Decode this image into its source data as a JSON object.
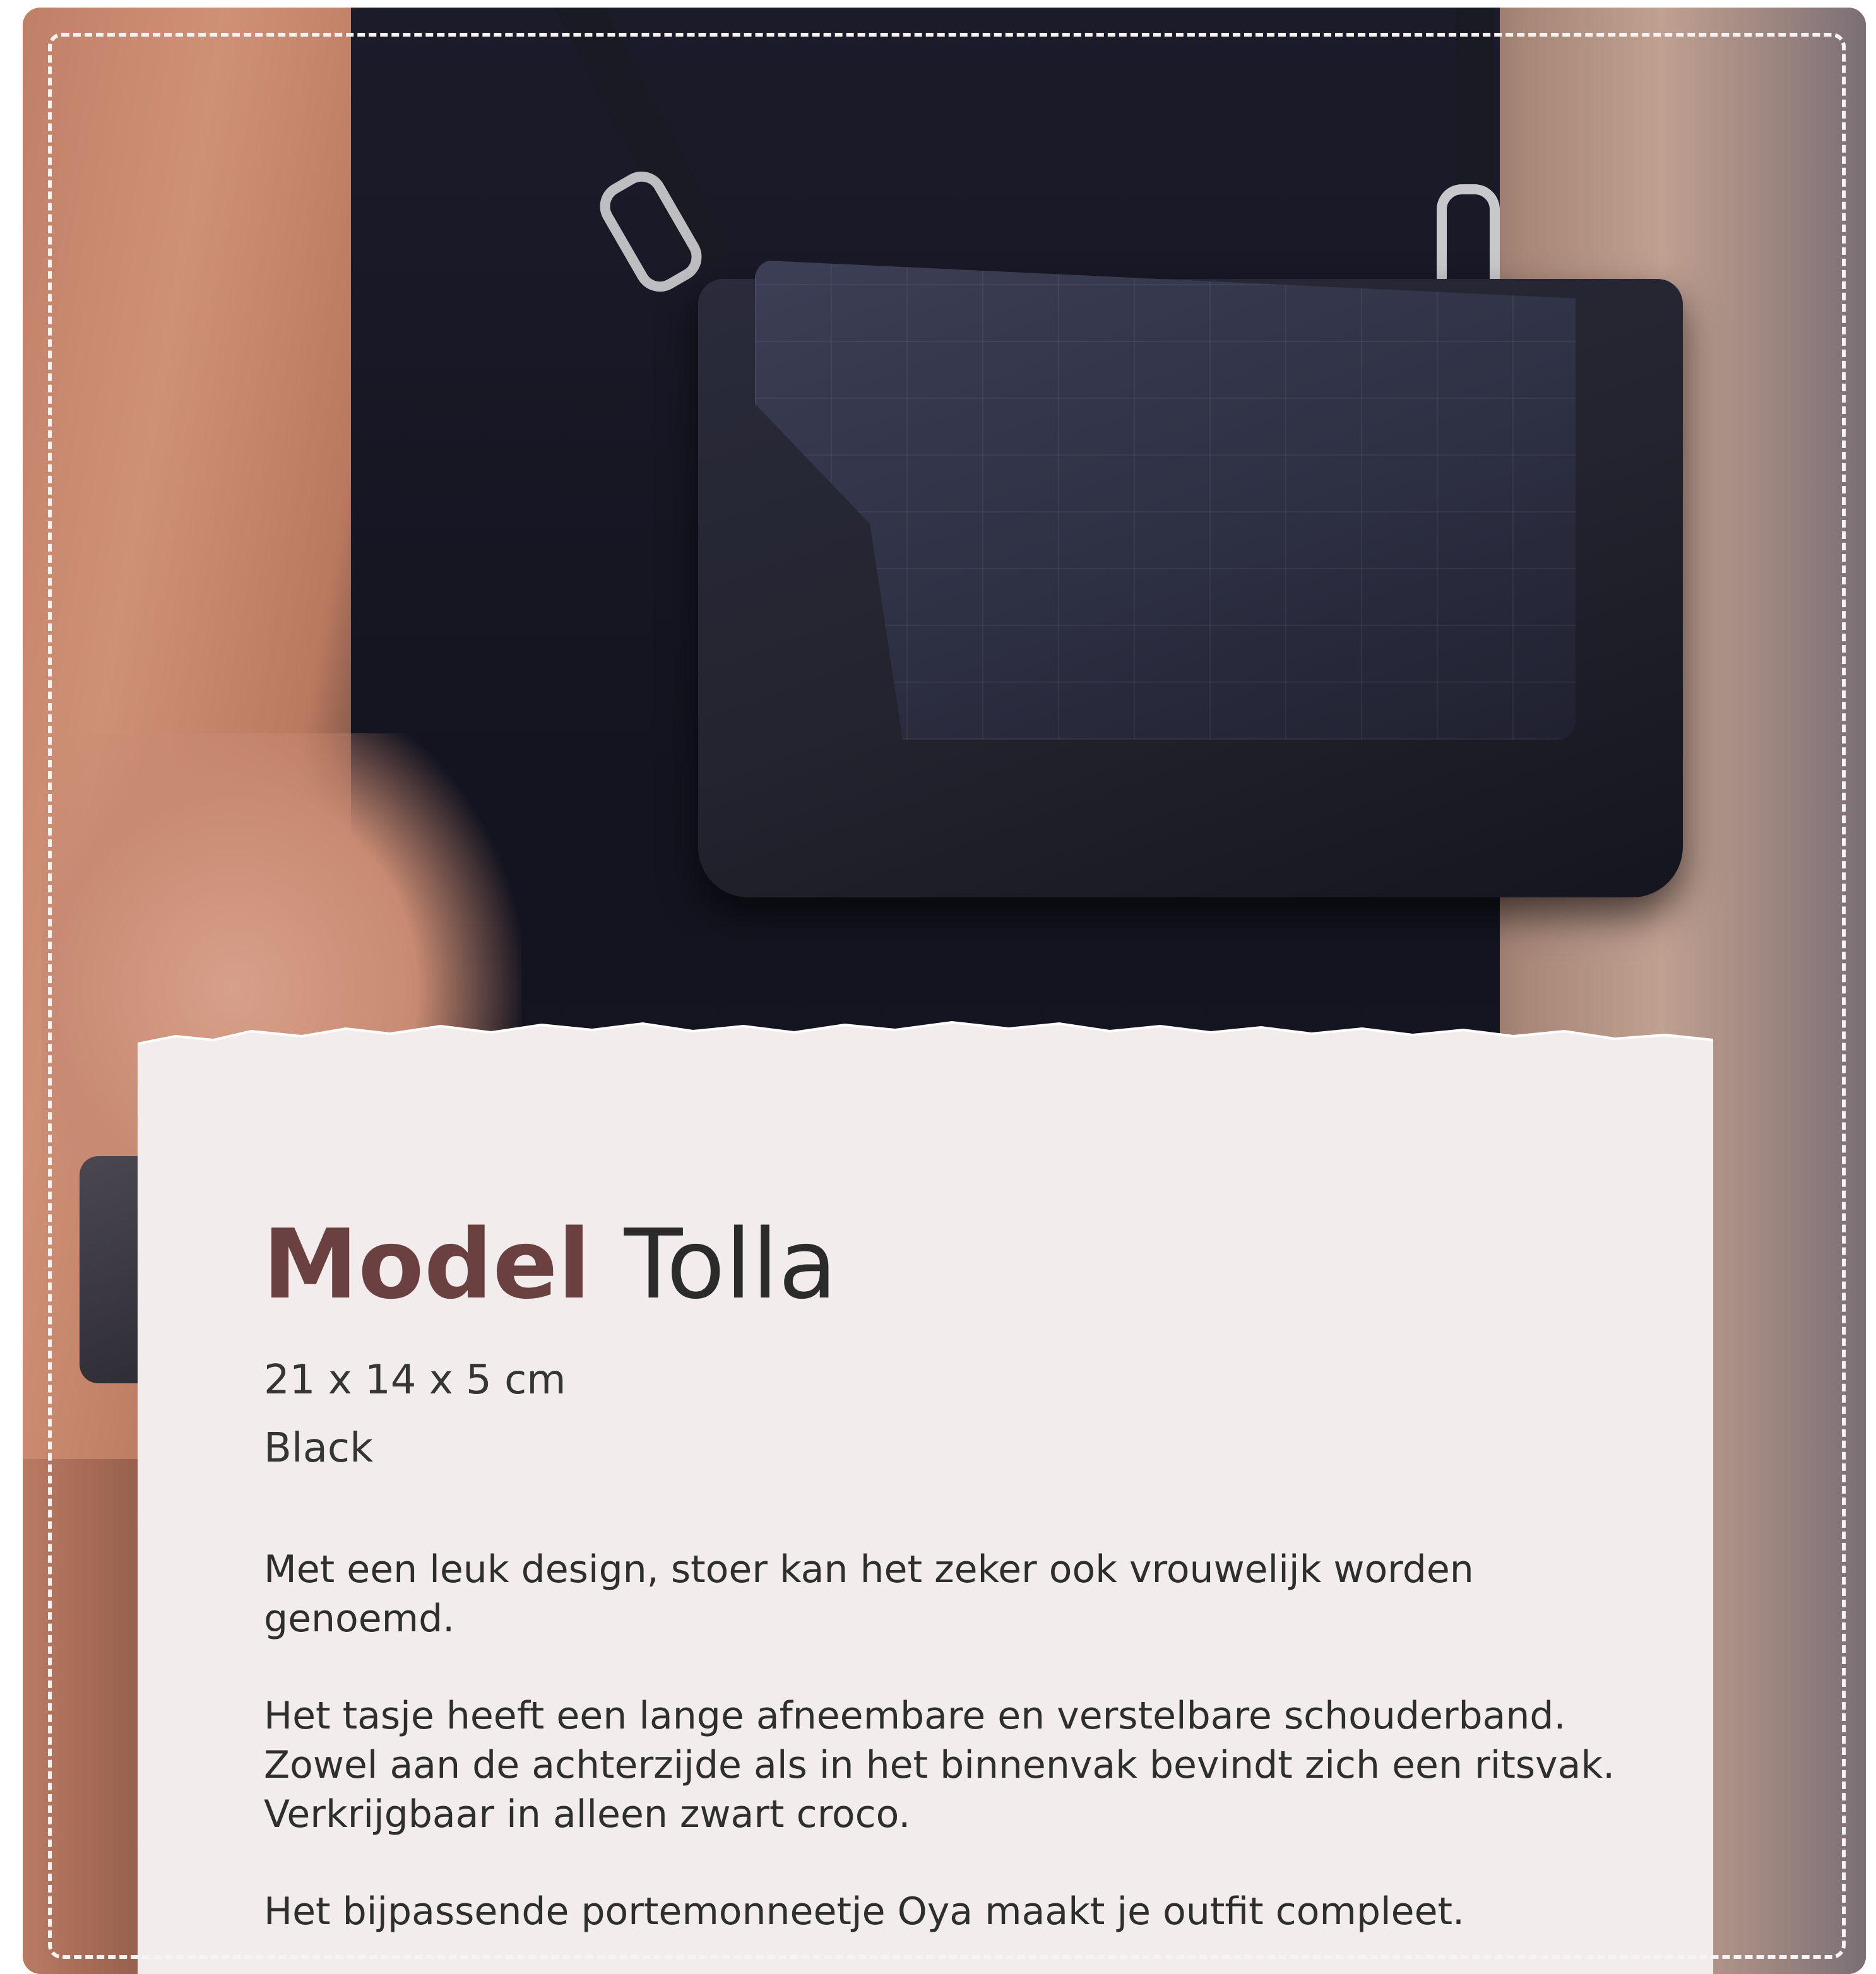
{
  "product": {
    "title_bold": "Model",
    "title_light": "Tolla",
    "dimensions": "21 x 14 x 5 cm",
    "color": "Black"
  },
  "description": {
    "paragraph_1": "Met een leuk design, stoer kan het zeker ook vrouwelijk worden genoemd.",
    "paragraph_2": "Het tasje heeft een lange afneembare en verstelbare schouderband. Zowel aan de achterzijde als in het binnenvak bevindt zich een ritsvak. Verkrijgbaar in alleen zwart croco.",
    "paragraph_3": "Het bijpassende portemonneetje Oya maakt je outfit compleet."
  },
  "colors": {
    "accent": "#6b4040",
    "panel": "#f3ecec",
    "text": "#2e2e2e"
  }
}
